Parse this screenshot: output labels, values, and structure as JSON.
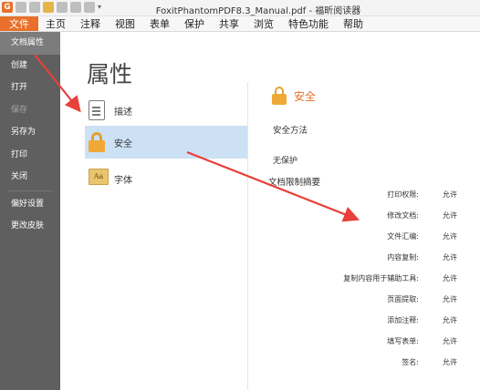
{
  "window": {
    "title": "FoxitPhantomPDF8.3_Manual.pdf - 福昕阅读器",
    "logo_text": "G"
  },
  "menu": {
    "items": [
      "文件",
      "主页",
      "注释",
      "视图",
      "表单",
      "保护",
      "共享",
      "浏览",
      "特色功能",
      "帮助"
    ]
  },
  "sidebar": {
    "items": [
      {
        "label": "文档属性"
      },
      {
        "label": "创建"
      },
      {
        "label": "打开"
      },
      {
        "label": "保存"
      },
      {
        "label": "另存为"
      },
      {
        "label": "打印"
      },
      {
        "label": "关闭"
      },
      {
        "label": "偏好设置"
      },
      {
        "label": "更改皮肤"
      }
    ]
  },
  "main": {
    "title": "属性",
    "categories": [
      {
        "label": "描述",
        "icon": "description-icon"
      },
      {
        "label": "安全",
        "icon": "lock-icon"
      },
      {
        "label": "字体",
        "icon": "font-icon"
      }
    ]
  },
  "security": {
    "title": "安全",
    "method_label": "安全方法",
    "method_value": "无保护",
    "summary_title": "文档限制摘要",
    "permissions": [
      {
        "label": "打印权限:",
        "value": "允许"
      },
      {
        "label": "修改文档:",
        "value": "允许"
      },
      {
        "label": "文件汇编:",
        "value": "允许"
      },
      {
        "label": "内容复制:",
        "value": "允许"
      },
      {
        "label": "复制内容用于辅助工具:",
        "value": "允许"
      },
      {
        "label": "页面提取:",
        "value": "允许"
      },
      {
        "label": "添加注释:",
        "value": "允许"
      },
      {
        "label": "填写表单:",
        "value": "允许"
      },
      {
        "label": "签名:",
        "value": "允许"
      }
    ]
  },
  "colors": {
    "accent": "#e8702a",
    "sidebar_bg": "#5f5f5f",
    "selected_bg": "#cde1f5",
    "annotation_arrow": "#e8403a"
  }
}
